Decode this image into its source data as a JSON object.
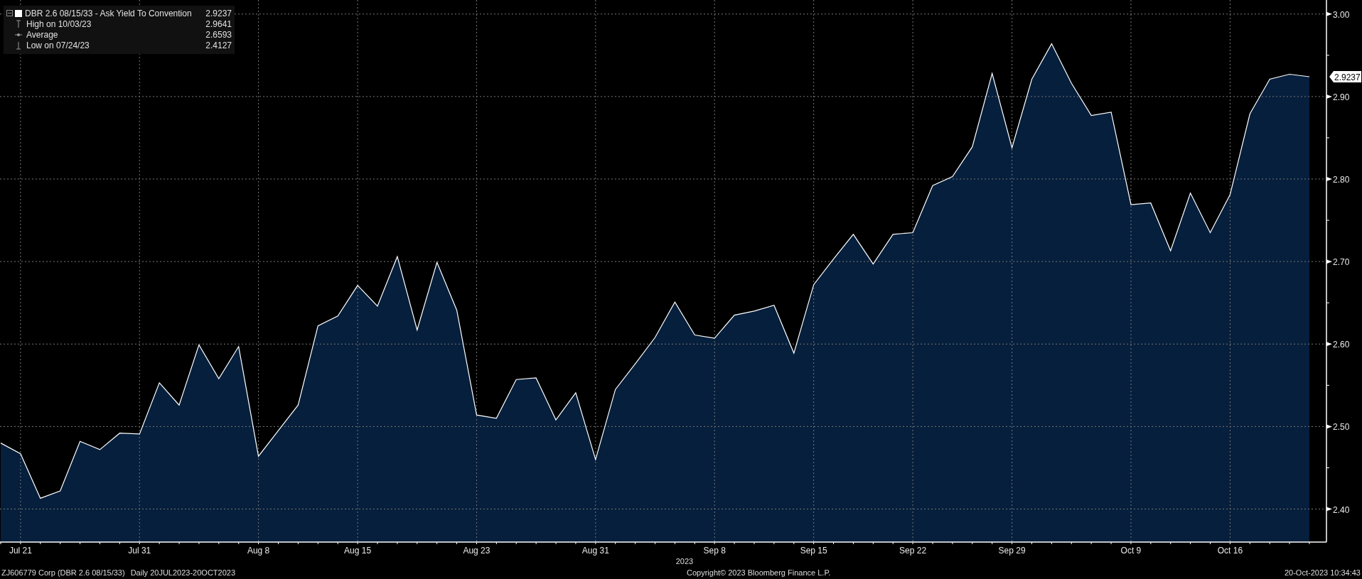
{
  "legend": {
    "series": {
      "value": "2.9237"
    },
    "stats": [
      {
        "kind": "high",
        "label": "High on 10/03/23",
        "value": "2.9641"
      },
      {
        "kind": "average",
        "label": "Average",
        "value": "2.6593"
      },
      {
        "kind": "low",
        "label": "Low on 07/24/23",
        "value": "2.4127"
      }
    ]
  },
  "chart": {
    "chart_data": {
      "type": "area",
      "xlabel": "2023",
      "categories": [
        null,
        "Jul 21",
        null,
        null,
        null,
        null,
        null,
        "Jul 31",
        null,
        null,
        null,
        null,
        null,
        "Aug 8",
        null,
        null,
        null,
        null,
        "Aug 15",
        null,
        null,
        null,
        null,
        null,
        "Aug 23",
        null,
        null,
        null,
        null,
        null,
        "Aug 31",
        null,
        null,
        null,
        null,
        null,
        "Sep 8",
        null,
        null,
        null,
        null,
        "Sep 15",
        null,
        null,
        null,
        null,
        "Sep 22",
        null,
        null,
        null,
        null,
        "Sep 29",
        null,
        null,
        null,
        null,
        null,
        "Oct 9",
        null,
        null,
        null,
        null,
        "Oct 16",
        null,
        null,
        null,
        null
      ],
      "grid": true,
      "series": [
        {
          "name": "DBR 2.6 08/15/33 - Ask Yield To Convention",
          "color": "#ffffff",
          "values": [
            2.48,
            2.467,
            2.413,
            2.422,
            2.482,
            2.472,
            2.492,
            2.491,
            2.553,
            2.526,
            2.599,
            2.558,
            2.597,
            2.464,
            2.495,
            2.526,
            2.622,
            2.634,
            2.671,
            2.646,
            2.706,
            2.617,
            2.699,
            2.641,
            2.514,
            2.51,
            2.557,
            2.559,
            2.508,
            2.541,
            2.46,
            2.545,
            2.576,
            2.608,
            2.651,
            2.611,
            2.607,
            2.635,
            2.64,
            2.647,
            2.589,
            2.672,
            2.703,
            2.733,
            2.697,
            2.733,
            2.735,
            2.792,
            2.803,
            2.839,
            2.928,
            2.838,
            2.921,
            2.964,
            2.916,
            2.877,
            2.881,
            2.769,
            2.771,
            2.713,
            2.783,
            2.735,
            2.781,
            2.879,
            2.921,
            2.927,
            2.924
          ]
        }
      ],
      "ylim": [
        2.36,
        3.017
      ],
      "yticks": [
        {
          "value": 2.4,
          "label": "2.40"
        },
        {
          "value": 2.5,
          "label": "2.50"
        },
        {
          "value": 2.6,
          "label": "2.60"
        },
        {
          "value": 2.7,
          "label": "2.70"
        },
        {
          "value": 2.8,
          "label": "2.80"
        },
        {
          "value": 2.9,
          "label": "2.90"
        },
        {
          "value": 3.0,
          "label": "3.00"
        }
      ],
      "annotations": [
        "2.9237"
      ]
    }
  },
  "footer": {
    "security": "ZJ606779 Corp (DBR 2.6 08/15/33)",
    "period": "Daily 20JUL2023-20OCT2023",
    "copyright": "Copyright© 2023 Bloomberg Finance L.P.",
    "timestamp": "20-Oct-2023 10:34:43"
  }
}
